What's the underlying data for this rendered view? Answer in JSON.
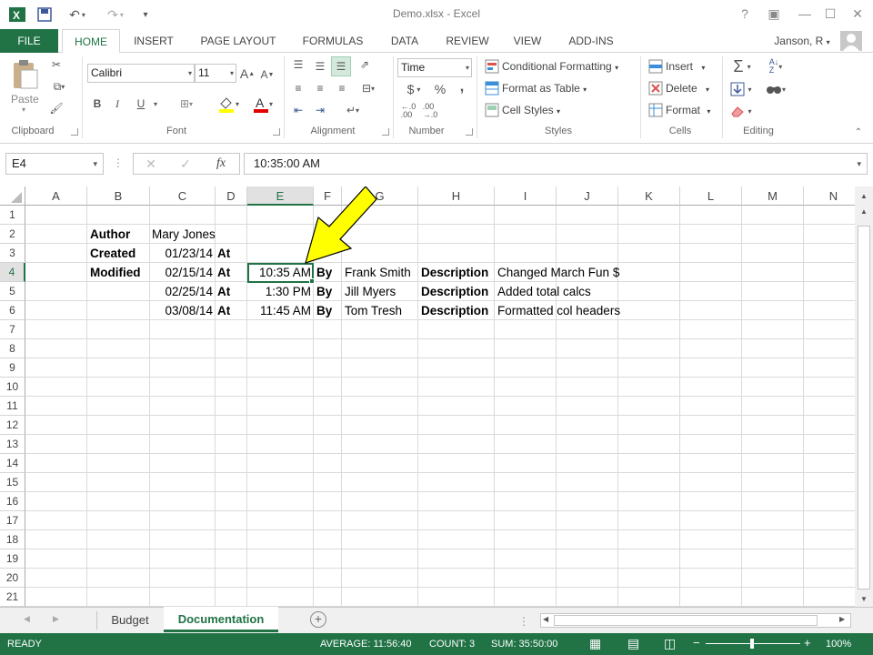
{
  "window": {
    "title": "Demo.xlsx - Excel",
    "controls": [
      "?",
      "▣",
      "—",
      "☐",
      "✕"
    ]
  },
  "user": {
    "name": "Janson, R"
  },
  "tabs": [
    "FILE",
    "HOME",
    "INSERT",
    "PAGE LAYOUT",
    "FORMULAS",
    "DATA",
    "REVIEW",
    "VIEW",
    "ADD-INS"
  ],
  "ribbon": {
    "clipboard": {
      "label": "Clipboard",
      "paste": "Paste"
    },
    "font": {
      "label": "Font",
      "family": "Calibri",
      "size": "11",
      "bold": "B",
      "italic": "I",
      "underline": "U",
      "grow": "A",
      "shrink": "A"
    },
    "alignment": {
      "label": "Alignment"
    },
    "number": {
      "label": "Number",
      "format": "Time",
      "currency": "$",
      "percent": "%",
      "comma": ",",
      "inc_dec": "←.0 .00",
      "dec_dec": ".00 →.0"
    },
    "styles": {
      "label": "Styles",
      "conditional": "Conditional Formatting",
      "format_table": "Format as Table",
      "cell_styles": "Cell Styles"
    },
    "cells": {
      "label": "Cells",
      "insert": "Insert",
      "delete": "Delete",
      "format": "Format"
    },
    "editing": {
      "label": "Editing",
      "sum": "Σ",
      "sort": "A Z",
      "find": "🔍"
    }
  },
  "formula_bar": {
    "name_box": "E4",
    "fx": "fx",
    "cancel": "✕",
    "enter": "✓",
    "value": "10:35:00 AM"
  },
  "columns": [
    "A",
    "B",
    "C",
    "D",
    "E",
    "F",
    "G",
    "H",
    "I",
    "J",
    "K",
    "L",
    "M",
    "N"
  ],
  "rows": [
    "1",
    "2",
    "3",
    "4",
    "5",
    "6",
    "7",
    "8",
    "9",
    "10",
    "11",
    "12",
    "13",
    "14",
    "15",
    "16",
    "17",
    "18",
    "19",
    "20",
    "21"
  ],
  "cells": {
    "b2": "Author",
    "c2": "Mary Jones",
    "b3": "Created",
    "c3": "01/23/14",
    "d3": "At",
    "b4": "Modified",
    "c4": "02/15/14",
    "d4": "At",
    "e4": "10:35 AM",
    "f4": "By",
    "g4": "Frank Smith",
    "h4": "Description",
    "i4": "Changed March Fun $",
    "c5": "02/25/14",
    "d5": "At",
    "e5": "1:30 PM",
    "f5": "By",
    "g5": "Jill Myers",
    "h5": "Description",
    "i5": "Added total calcs",
    "c6": "03/08/14",
    "d6": "At",
    "e6": "11:45 AM",
    "f6": "By",
    "g6": "Tom Tresh",
    "h6": "Description",
    "i6": "Formatted col headers"
  },
  "sheets": [
    "Budget",
    "Documentation"
  ],
  "active_sheet": "Documentation",
  "status": {
    "mode": "READY",
    "average": "AVERAGE: 11:56:40",
    "count": "COUNT: 3",
    "sum": "SUM: 35:50:00",
    "zoom": "100%"
  },
  "colors": {
    "accent": "#217346",
    "arrow": "#ffff00"
  }
}
